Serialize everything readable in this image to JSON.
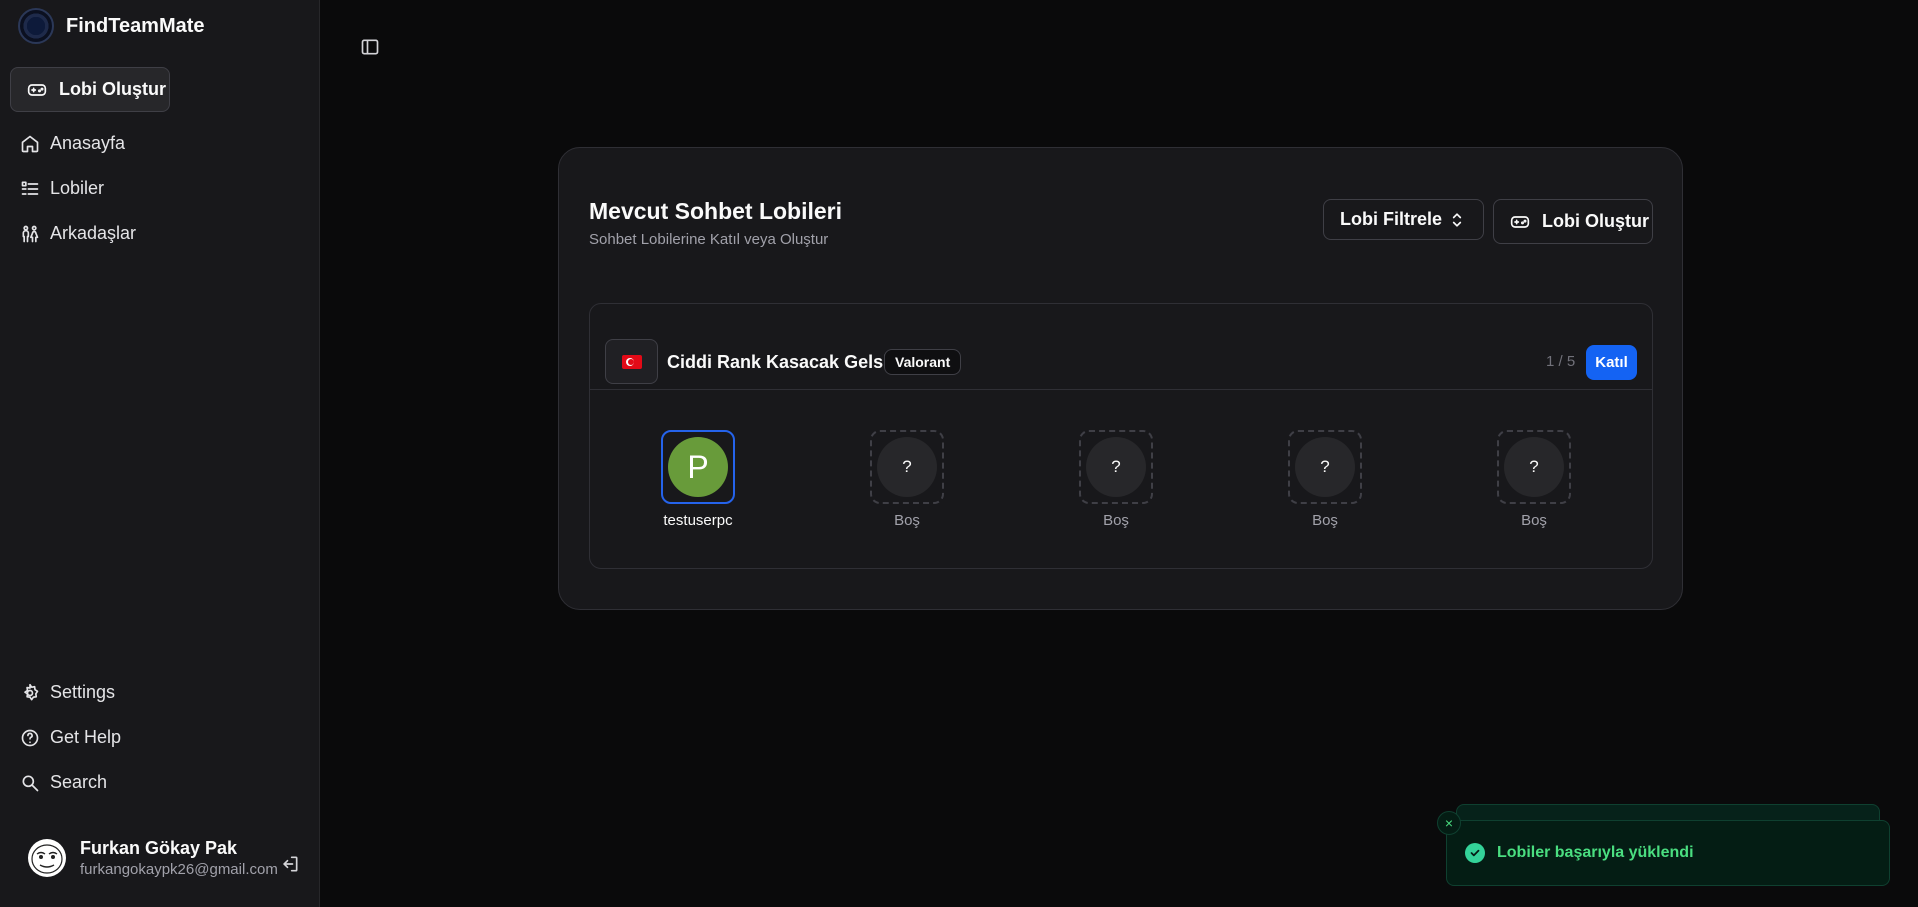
{
  "app": {
    "name": "FindTeamMate"
  },
  "sidebar": {
    "create_label": "Lobi Oluştur",
    "nav_top": [
      {
        "label": "Anasayfa",
        "icon": "home-icon"
      },
      {
        "label": "Lobiler",
        "icon": "list-icon"
      },
      {
        "label": "Arkadaşlar",
        "icon": "friends-icon"
      }
    ],
    "nav_bottom": [
      {
        "label": "Settings",
        "icon": "gear-icon"
      },
      {
        "label": "Get Help",
        "icon": "help-icon"
      },
      {
        "label": "Search",
        "icon": "search-icon"
      }
    ],
    "user": {
      "name": "Furkan Gökay Pak",
      "email": "furkangokaypk26@gmail.com"
    }
  },
  "main": {
    "title": "Mevcut Sohbet Lobileri",
    "subtitle": "Sohbet Lobilerine Katıl veya Oluştur",
    "filter_label": "Lobi Filtrele",
    "create_label": "Lobi Oluştur",
    "lobby": {
      "name": "Ciddi Rank Kasacak Gelsin",
      "game": "Valorant",
      "count": "1 / 5",
      "join_label": "Katıl",
      "slots": [
        {
          "initial": "P",
          "label": "testuserpc",
          "filled": true
        },
        {
          "initial": "?",
          "label": "Boş",
          "filled": false
        },
        {
          "initial": "?",
          "label": "Boş",
          "filled": false
        },
        {
          "initial": "?",
          "label": "Boş",
          "filled": false
        },
        {
          "initial": "?",
          "label": "Boş",
          "filled": false
        }
      ]
    }
  },
  "toast": {
    "message": "Lobiler başarıyla yüklendi",
    "close": "×"
  },
  "colors": {
    "accent": "#1463f3",
    "success": "#4ade80",
    "avatar": "#689b3a"
  }
}
